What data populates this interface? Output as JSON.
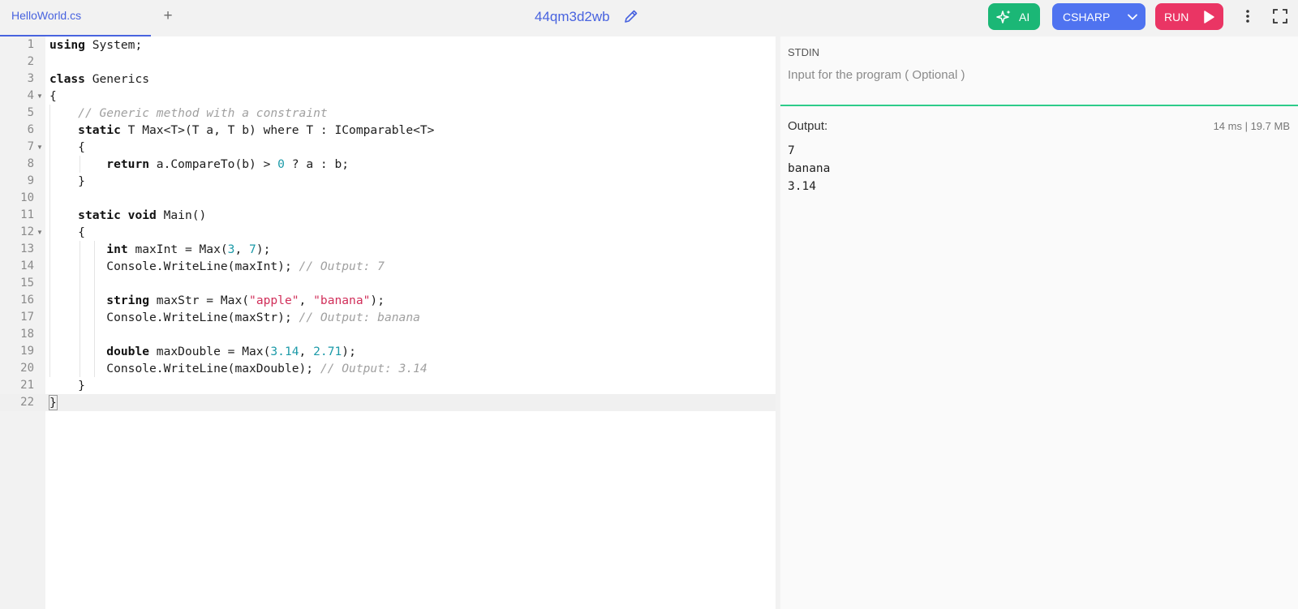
{
  "tabs": {
    "active_file": "HelloWorld.cs",
    "add_label": "+"
  },
  "project": {
    "name": "44qm3d2wb"
  },
  "toolbar": {
    "ai_label": "AI",
    "language_label": "CSHARP",
    "run_label": "RUN"
  },
  "editor": {
    "line_numbers": [
      "1",
      "2",
      "3",
      "4",
      "5",
      "6",
      "7",
      "8",
      "9",
      "10",
      "11",
      "12",
      "13",
      "14",
      "15",
      "16",
      "17",
      "18",
      "19",
      "20",
      "21",
      "22"
    ],
    "tokens": {
      "l1_kw": "using",
      "l1_rest": " System;",
      "l3_kw": "class",
      "l3_rest": " Generics",
      "l4": "{",
      "l5_cm": "// Generic method with a constraint",
      "l6_kw": "static",
      "l6_rest": " T Max<T>(T a, T b) where T : IComparable<T>",
      "l7": "{",
      "l8_kw": "return",
      "l8_a": " a.CompareTo(b) > ",
      "l8_num": "0",
      "l8_b": " ? a : b;",
      "l9": "}",
      "l11_kw1": "static",
      "l11_sp": " ",
      "l11_kw2": "void",
      "l11_rest": " Main()",
      "l12": "{",
      "l13_kw": "int",
      "l13_a": " maxInt = Max(",
      "l13_n1": "3",
      "l13_c": ", ",
      "l13_n2": "7",
      "l13_b": ");",
      "l14_a": "Console.WriteLine(maxInt); ",
      "l14_cm": "// Output: 7",
      "l16_kw": "string",
      "l16_a": " maxStr = Max(",
      "l16_s1": "\"apple\"",
      "l16_c": ", ",
      "l16_s2": "\"banana\"",
      "l16_b": ");",
      "l17_a": "Console.WriteLine(maxStr); ",
      "l17_cm": "// Output: banana",
      "l19_kw": "double",
      "l19_a": " maxDouble = Max(",
      "l19_n1": "3.14",
      "l19_c": ", ",
      "l19_n2": "2.71",
      "l19_b": ");",
      "l20_a": "Console.WriteLine(maxDouble); ",
      "l20_cm": "// Output: 3.14",
      "l21": "}",
      "l22": "}"
    },
    "fold_markers": [
      "4",
      "7",
      "12"
    ]
  },
  "stdin": {
    "label": "STDIN",
    "placeholder": "Input for the program ( Optional )"
  },
  "output": {
    "label": "Output:",
    "stats": "14 ms | 19.7 MB",
    "lines": [
      "7",
      "banana",
      "3.14"
    ]
  },
  "colors": {
    "accent": "#4863df",
    "ai_button": "#1bb776",
    "lang_button": "#4f73f0",
    "run_button": "#ea3564",
    "stdin_border": "#2ecc8a"
  },
  "icons": {
    "ai": "sparkle-icon",
    "language": "chevron-down-icon",
    "run": "play-icon",
    "edit": "pencil-icon",
    "menu": "kebab-menu-icon",
    "fullscreen": "fullscreen-icon"
  }
}
